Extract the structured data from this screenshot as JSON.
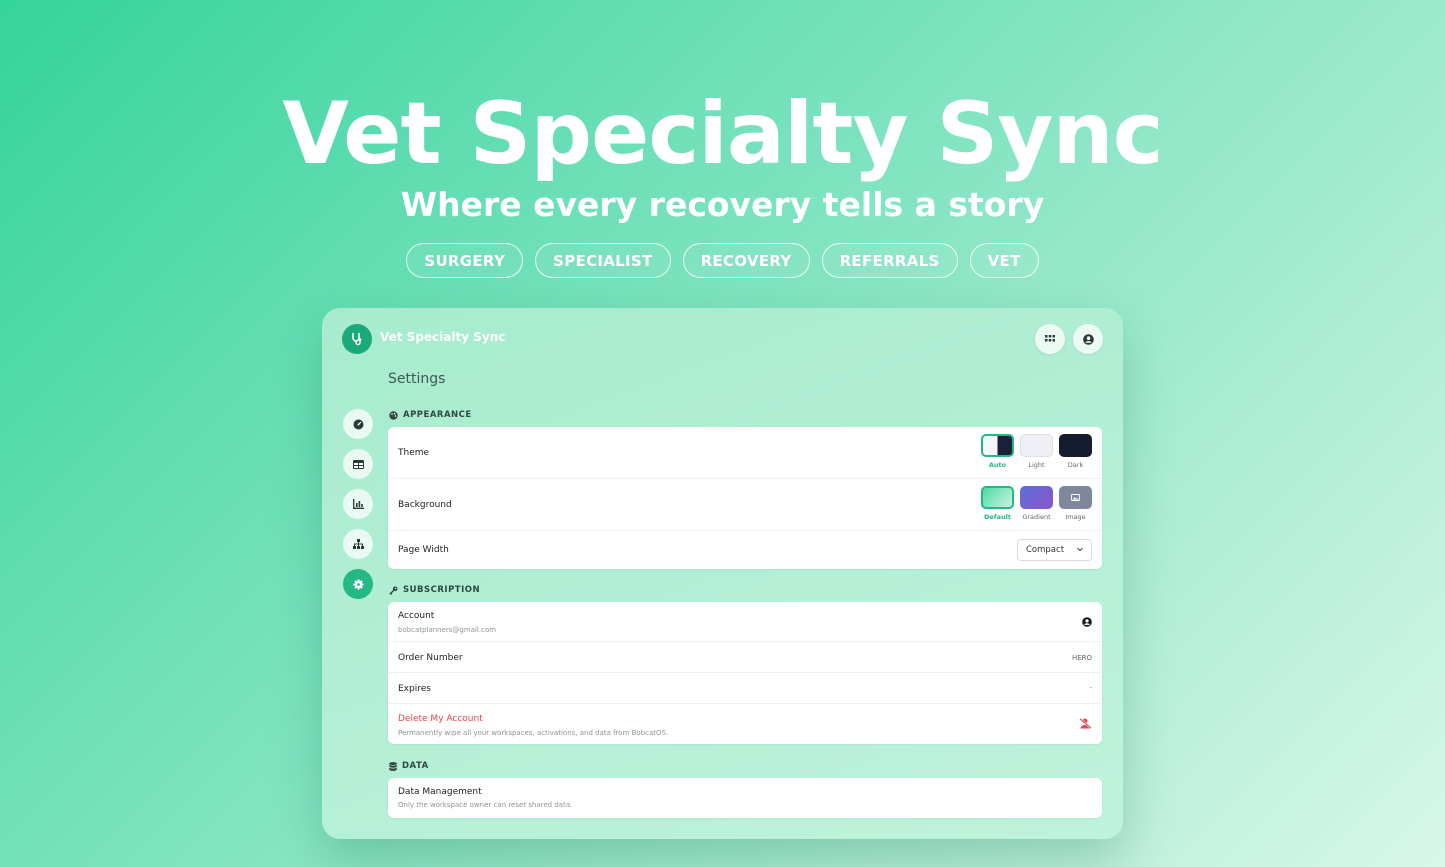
{
  "hero": {
    "title": "Vet Specialty Sync",
    "subtitle": "Where every recovery tells a story",
    "tags": [
      "SURGERY",
      "SPECIALIST",
      "RECOVERY",
      "REFERRALS",
      "VET"
    ]
  },
  "app": {
    "title": "Vet Specialty Sync",
    "page_title": "Settings",
    "accent_color": "#23b884"
  },
  "sidebar": {
    "items": [
      {
        "icon": "gauge-icon",
        "active": false
      },
      {
        "icon": "table-icon",
        "active": false
      },
      {
        "icon": "chart-icon",
        "active": false
      },
      {
        "icon": "sitemap-icon",
        "active": false
      },
      {
        "icon": "gear-icon",
        "active": true
      }
    ]
  },
  "appearance": {
    "heading": "APPEARANCE",
    "theme": {
      "label": "Theme",
      "options": [
        {
          "label": "Auto",
          "selected": true
        },
        {
          "label": "Light",
          "selected": false
        },
        {
          "label": "Dark",
          "selected": false
        }
      ]
    },
    "background": {
      "label": "Background",
      "options": [
        {
          "label": "Default",
          "selected": true
        },
        {
          "label": "Gradient",
          "selected": false
        },
        {
          "label": "Image",
          "selected": false
        }
      ]
    },
    "page_width": {
      "label": "Page Width",
      "value": "Compact"
    }
  },
  "subscription": {
    "heading": "SUBSCRIPTION",
    "account": {
      "label": "Account",
      "email": "bobcatplanners@gmail.com"
    },
    "order": {
      "label": "Order Number",
      "value": "HERO"
    },
    "expires": {
      "label": "Expires",
      "value": "-"
    },
    "delete": {
      "label": "Delete My Account",
      "description": "Permanently wipe all your workspaces, activations, and data from BobcatOS.",
      "color": "#e5484d"
    }
  },
  "data_section": {
    "heading": "DATA",
    "management": {
      "label": "Data Management",
      "description": "Only the workspace owner can reset shared data."
    }
  }
}
